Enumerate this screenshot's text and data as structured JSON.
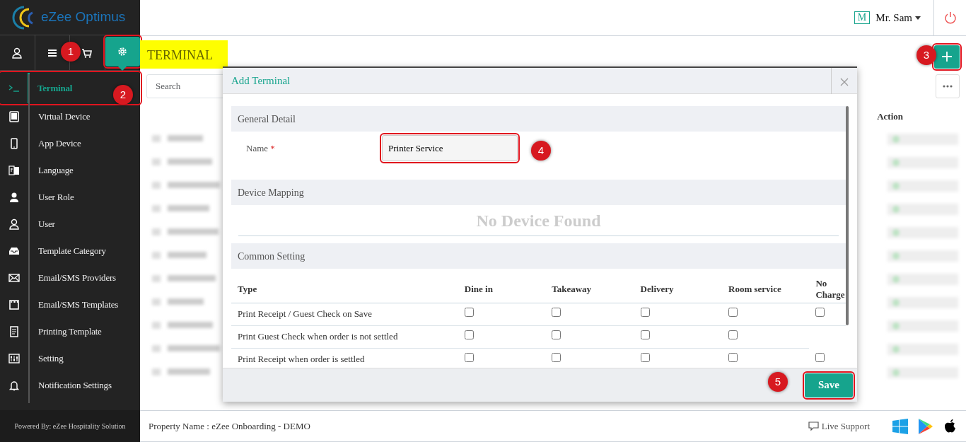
{
  "app": {
    "logo_text": "eZee Optimus"
  },
  "header": {
    "user_initial": "M",
    "user_name": "Mr. Sam"
  },
  "sidebar_tabs": [
    {
      "kind": "user",
      "selected": false
    },
    {
      "kind": "menu",
      "selected": false
    },
    {
      "kind": "cart",
      "selected": false
    },
    {
      "kind": "settings",
      "selected": true,
      "highlight": true
    }
  ],
  "menu": [
    {
      "kind": "terminal",
      "label": "Terminal",
      "selected": true,
      "highlight": true
    },
    {
      "kind": "tablet",
      "label": "Virtual Device",
      "selected": false
    },
    {
      "kind": "phone",
      "label": "App Device",
      "selected": false
    },
    {
      "kind": "language",
      "label": "Language",
      "selected": false
    },
    {
      "kind": "person",
      "label": "User Role",
      "selected": false
    },
    {
      "kind": "user",
      "label": "User",
      "selected": false
    },
    {
      "kind": "inbox",
      "label": "Template Category",
      "selected": false
    },
    {
      "kind": "mail",
      "label": "Email/SMS Providers",
      "selected": false
    },
    {
      "kind": "calendar",
      "label": "Email/SMS Templates",
      "selected": false
    },
    {
      "kind": "receipt",
      "label": "Printing Template",
      "selected": false
    },
    {
      "kind": "sliders",
      "label": "Setting",
      "selected": false
    },
    {
      "kind": "bell",
      "label": "Notification Settings",
      "selected": false
    }
  ],
  "powered_by": "Powered By: eZee Hospitality Solution",
  "page": {
    "title": "TERMINAL",
    "search_placeholder": "Search",
    "action_header": "Action",
    "add_highlight": true
  },
  "modal": {
    "title": "Add Terminal",
    "general_header": "General Detail",
    "name_label": "Name",
    "required_mark": "*",
    "name_value": "Printer Service",
    "name_highlight": true,
    "device_header": "Device Mapping",
    "no_device": "No Device Found",
    "common_header": "Common Setting",
    "columns": [
      "Type",
      "Dine in",
      "Takeaway",
      "Delivery",
      "Room service",
      "No Charge"
    ],
    "rows": [
      {
        "type": "Print Receipt / Guest Check on Save",
        "checks": [
          false,
          false,
          false,
          false,
          false
        ]
      },
      {
        "type": "Print Guest Check when order is not settled",
        "checks": [
          false,
          false,
          false,
          false
        ]
      },
      {
        "type": "Print Receipt when order is settled",
        "checks": [
          false,
          false,
          false,
          false,
          false
        ]
      }
    ],
    "save_label": "Save",
    "save_highlight": true
  },
  "footer": {
    "property": "Property Name : eZee Onboarding - DEMO",
    "live_support": "Live Support"
  },
  "callouts": [
    "1",
    "2",
    "3",
    "4",
    "5"
  ]
}
